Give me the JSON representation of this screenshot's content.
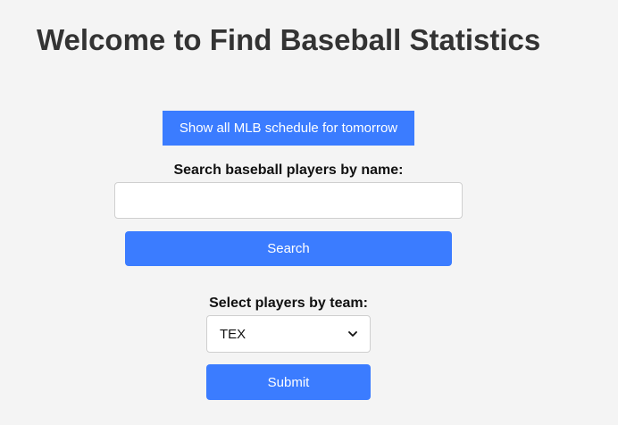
{
  "header": {
    "title": "Welcome to Find Baseball Statistics"
  },
  "schedule": {
    "button_label": "Show all MLB schedule for tomorrow"
  },
  "search": {
    "label": "Search baseball players by name:",
    "value": "",
    "placeholder": "",
    "button_label": "Search"
  },
  "team": {
    "label": "Select players by team:",
    "selected": "TEX",
    "icon": "chevron-down-icon",
    "submit_label": "Submit"
  },
  "colors": {
    "background": "#f4f4f4",
    "accent": "#3b7cff",
    "title_text": "#333333"
  }
}
